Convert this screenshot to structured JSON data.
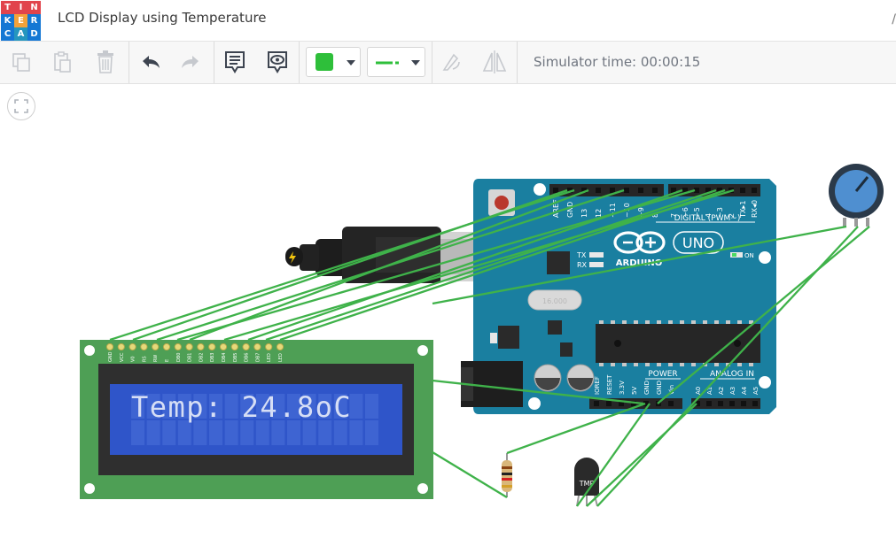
{
  "app": {
    "logo_letters": [
      "T",
      "I",
      "N",
      "K",
      "E",
      "R",
      "C",
      "A",
      "D"
    ],
    "logo_colors": [
      "#e1444c",
      "#e1444c",
      "#e1444c",
      "#1477d4",
      "#f2a23a",
      "#1477d4",
      "#1477d4",
      "#2596be",
      "#1477d4"
    ],
    "project_title": "LCD Display using Temperature",
    "corner_mark": "/"
  },
  "toolbar": {
    "copy_icon": "copy-icon",
    "paste_icon": "paste-icon",
    "delete_icon": "trash-icon",
    "undo_icon": "undo-icon",
    "redo_icon": "redo-icon",
    "notes_icon": "notes-icon",
    "view_icon": "eye-icon",
    "color_swatch": "#2ebf3a",
    "wire_style_icon": "wire-style-icon",
    "rotate_icon": "rotate-icon",
    "mirror_icon": "mirror-icon",
    "simulator_time": "Simulator time: 00:00:15"
  },
  "canvas": {
    "fit_icon": "fit-view-icon",
    "wire_color": "#3fb24a",
    "lcd": {
      "text": "Temp: 24.8oC",
      "pins": [
        "GND",
        "VCC",
        "V0",
        "RS",
        "RW",
        "E",
        "DB0",
        "DB1",
        "DB2",
        "DB3",
        "DB4",
        "DB5",
        "DB6",
        "DB7",
        "LED",
        "LED"
      ]
    },
    "arduino": {
      "aref": "AREF",
      "gnd": "GND",
      "digital_pins": [
        "13",
        "12",
        "~11",
        "~10",
        "~9",
        "8",
        "7",
        "~6",
        "~5",
        "4",
        "~3",
        "2",
        "TX▸1",
        "RX◂0"
      ],
      "digital_label": "DIGITAL (PWM~)",
      "brand": "ARDUINO",
      "model": "UNO",
      "tx": "TX",
      "rx": "RX",
      "on": "ON",
      "crystal": "16.000",
      "power_label": "POWER",
      "power_pins": [
        "IOREF",
        "RESET",
        "3.3V",
        "5V",
        "GND",
        "GND",
        "Vin"
      ],
      "analog_label": "ANALOG IN",
      "analog_pins": [
        "A0",
        "A1",
        "A2",
        "A3",
        "A4",
        "A5"
      ]
    },
    "sensor_label": "TMP",
    "usb_icon": "lightning-icon"
  }
}
